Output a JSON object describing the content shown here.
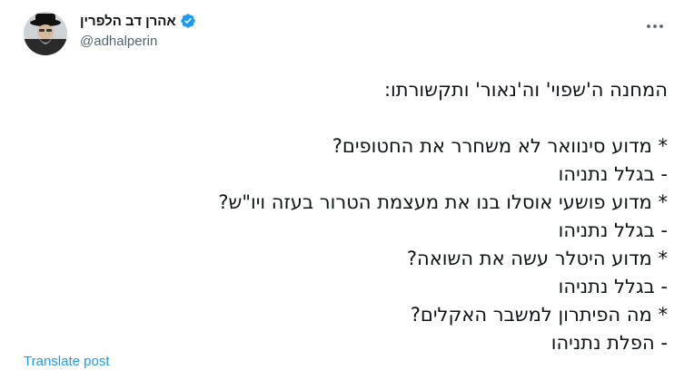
{
  "author": {
    "display_name": "אהרן דב הלפרין",
    "handle": "@adhalperin",
    "verified_icon": "verified-badge-icon",
    "avatar_icon": "avatar-photo"
  },
  "menu": {
    "icon": "more-horizontal-icon"
  },
  "post": {
    "title": "המחנה ה'שפוי' וה'נאור' ותקשורתו:",
    "lines": [
      "* מדוע סינוואר לא משחרר את החטופים?",
      "- בגלל נתניהו",
      "* מדוע פושעי אוסלו בנו את מעצמת הטרור בעזה ויו\"ש?",
      "- בגלל נתניהו",
      "* מדוע היטלר עשה את השואה?",
      "- בגלל נתניהו",
      "* מה הפיתרון למשבר האקלים?",
      "- הפלת נתניהו"
    ]
  },
  "translate_label": "Translate post",
  "colors": {
    "link": "#1d9bf0",
    "secondary": "#536471",
    "text": "#0f1419"
  }
}
